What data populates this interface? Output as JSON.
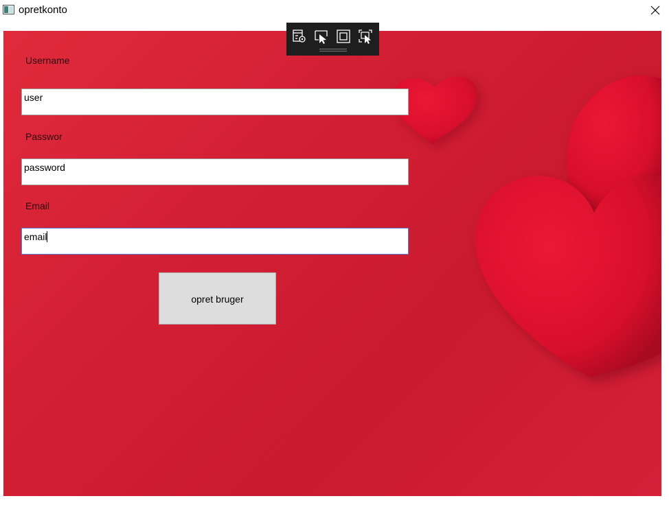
{
  "window": {
    "title": "opretkonto",
    "icons": {
      "app": "window-app-icon",
      "close": "close-icon"
    }
  },
  "form": {
    "username_label": "Username",
    "username_value": "user",
    "password_label": "Passwor",
    "password_value": "password",
    "email_label": "Email",
    "email_value": "email",
    "submit_label": "opret bruger"
  },
  "debug_toolbar": {
    "icons": [
      "live-visual-tree-icon",
      "select-element-icon",
      "display-layout-adorners-icon",
      "track-focused-element-icon"
    ]
  },
  "background": {
    "description_colors": {
      "base": "#d31f34",
      "heart": "#e0102e"
    }
  }
}
